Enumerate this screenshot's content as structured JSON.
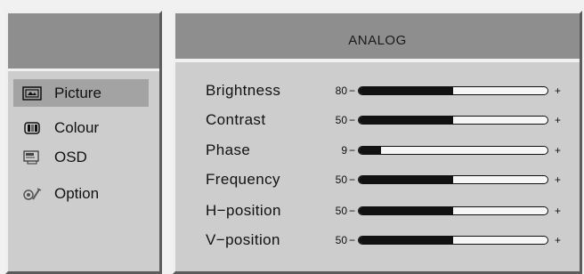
{
  "sidebar": {
    "items": [
      {
        "label": "Picture",
        "icon": "picture-icon",
        "selected": true
      },
      {
        "label": "Colour",
        "icon": "colour-icon",
        "selected": false
      },
      {
        "label": "OSD",
        "icon": "osd-icon",
        "selected": false
      },
      {
        "label": "Option",
        "icon": "option-icon",
        "selected": false
      }
    ]
  },
  "main": {
    "title": "ANALOG",
    "settings": [
      {
        "label": "Brightness",
        "value": "80",
        "level": 0.5
      },
      {
        "label": "Contrast",
        "value": "50",
        "level": 0.5
      },
      {
        "label": "Phase",
        "value": "9",
        "level": 0.12
      },
      {
        "label": "Frequency",
        "value": "50",
        "level": 0.5
      },
      {
        "label": "H−position",
        "value": "50",
        "level": 0.5
      },
      {
        "label": "V−position",
        "value": "50",
        "level": 0.5
      }
    ],
    "minus_symbol": "−",
    "plus_symbol": "+"
  },
  "colors": {
    "panel": "#cdcdcd",
    "header": "#8e8e8e",
    "selected": "#a3a3a3",
    "slider_fill": "#111111"
  }
}
